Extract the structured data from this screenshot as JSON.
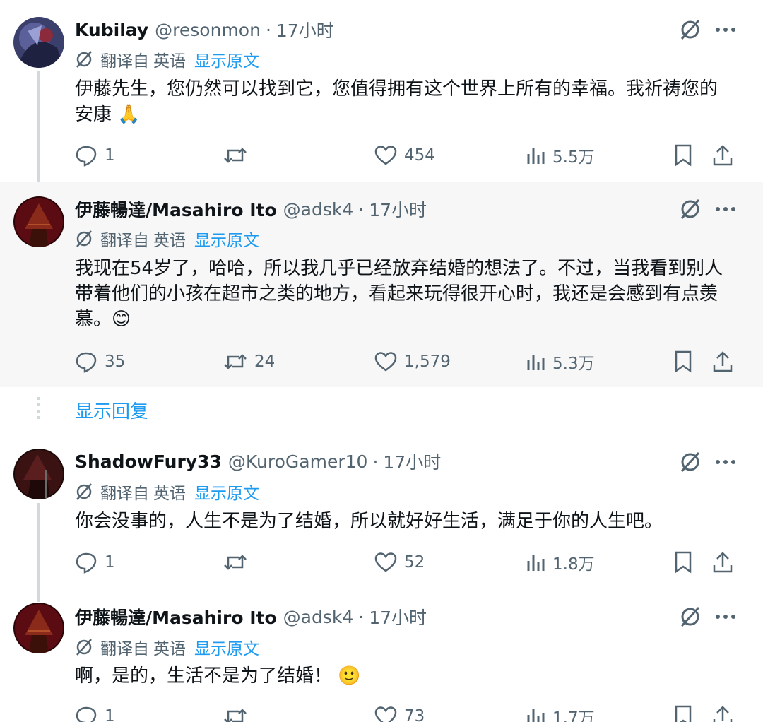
{
  "tweets": [
    {
      "name": "Kubilay",
      "handle": "@resonmon",
      "dot": "·",
      "time": "17小时",
      "translate": {
        "from": "翻译自",
        "lang": "英语",
        "show_original": "显示原文"
      },
      "text": "伊藤先生，您仍然可以找到它，您值得拥有这个世界上所有的幸福。我祈祷您的安康 🙏",
      "stats": {
        "replies": "1",
        "retweets": "",
        "likes": "454",
        "views": "5.5万"
      }
    },
    {
      "name": "伊藤暢達/Masahiro Ito",
      "handle": "@adsk4",
      "dot": "·",
      "time": "17小时",
      "translate": {
        "from": "翻译自",
        "lang": "英语",
        "show_original": "显示原文"
      },
      "text": "我现在54岁了，哈哈，所以我几乎已经放弃结婚的想法了。不过，当我看到别人带着他们的小孩在超市之类的地方，看起来玩得很开心时，我还是会感到有点羡慕。😊",
      "stats": {
        "replies": "35",
        "retweets": "24",
        "likes": "1,579",
        "views": "5.3万"
      }
    },
    {
      "name": "ShadowFury33",
      "handle": "@KuroGamer10",
      "dot": "·",
      "time": "17小时",
      "translate": {
        "from": "翻译自",
        "lang": "英语",
        "show_original": "显示原文"
      },
      "text": "你会没事的，人生不是为了结婚，所以就好好生活，满足于你的人生吧。",
      "stats": {
        "replies": "1",
        "retweets": "",
        "likes": "52",
        "views": "1.8万"
      }
    },
    {
      "name": "伊藤暢達/Masahiro Ito",
      "handle": "@adsk4",
      "dot": "·",
      "time": "17小时",
      "translate": {
        "from": "翻译自",
        "lang": "英语",
        "show_original": "显示原文"
      },
      "text": "啊，是的，生活不是为了结婚！ 🙂",
      "stats": {
        "replies": "1",
        "retweets": "",
        "likes": "73",
        "views": "1.7万"
      }
    }
  ],
  "show_replies": "显示回复",
  "icons": {
    "grok": "grok-icon",
    "more": "more-icon",
    "translate": "translate-icon",
    "reply": "reply-icon",
    "retweet": "retweet-icon",
    "like": "heart-icon",
    "views": "views-icon",
    "bookmark": "bookmark-icon",
    "share": "share-icon"
  },
  "colors": {
    "link": "#1d9bf0",
    "muted": "#536471",
    "text": "#0f1419",
    "highlight_bg": "#f7f7f7",
    "thread_line": "#cfd9de"
  }
}
